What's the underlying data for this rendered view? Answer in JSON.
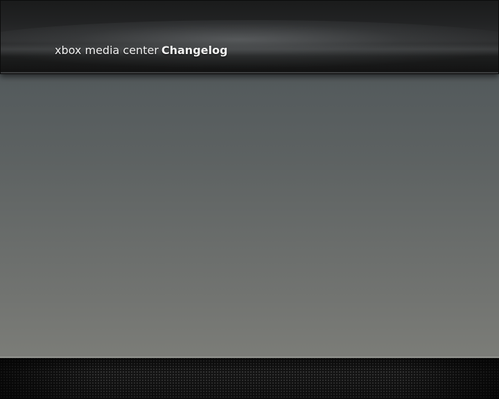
{
  "header": {
    "app_name": "xbox media center",
    "section_title": "Changelog"
  },
  "colors": {
    "title_text": "#f2f2f2",
    "background_top": "#4a5256",
    "background_bottom": "#82837d",
    "header_bar": "#1b1c1c",
    "footer_bar": "#141414"
  }
}
